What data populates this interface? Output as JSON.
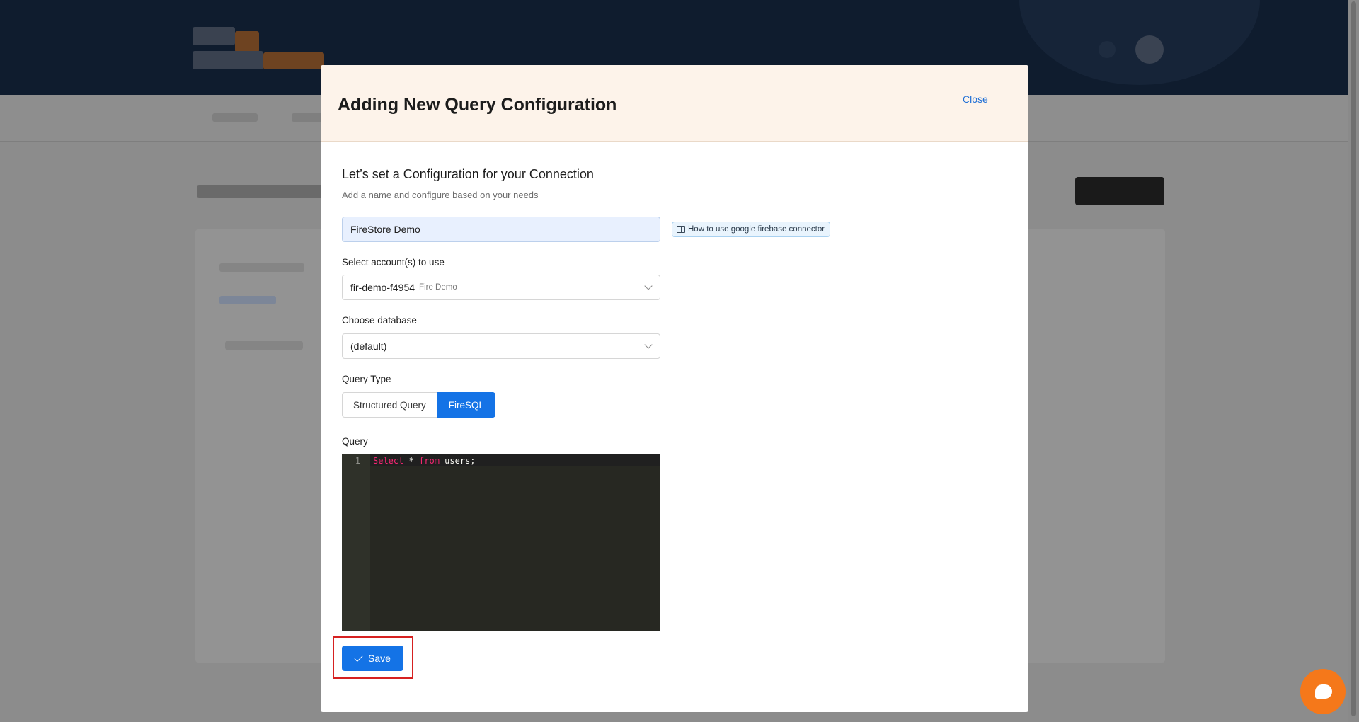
{
  "modal": {
    "title": "Adding New Query Configuration",
    "close_label": "Close",
    "section_title": "Let’s set a Configuration for your Connection",
    "section_subtitle": "Add a name and configure based on your needs",
    "name_value": "FireStore Demo",
    "help_link": {
      "icon": "book-icon",
      "label": "How to use google firebase connector"
    },
    "account": {
      "label": "Select account(s) to use",
      "value": "fir-demo-f4954",
      "value_sub": "Fire Demo"
    },
    "database": {
      "label": "Choose database",
      "value": "(default)"
    },
    "query_type": {
      "label": "Query Type",
      "options": [
        "Structured Query",
        "FireSQL"
      ],
      "selected": "FireSQL"
    },
    "query": {
      "label": "Query",
      "line_number": "1",
      "tokens": {
        "kw1": "Select",
        "op": " * ",
        "kw2": "from",
        "rest": " users;"
      }
    },
    "save_label": "Save"
  },
  "colors": {
    "accent": "#1473e6",
    "header_bg": "#fdf3ea",
    "highlight_border": "#d62121",
    "chat": "#f5781a"
  }
}
